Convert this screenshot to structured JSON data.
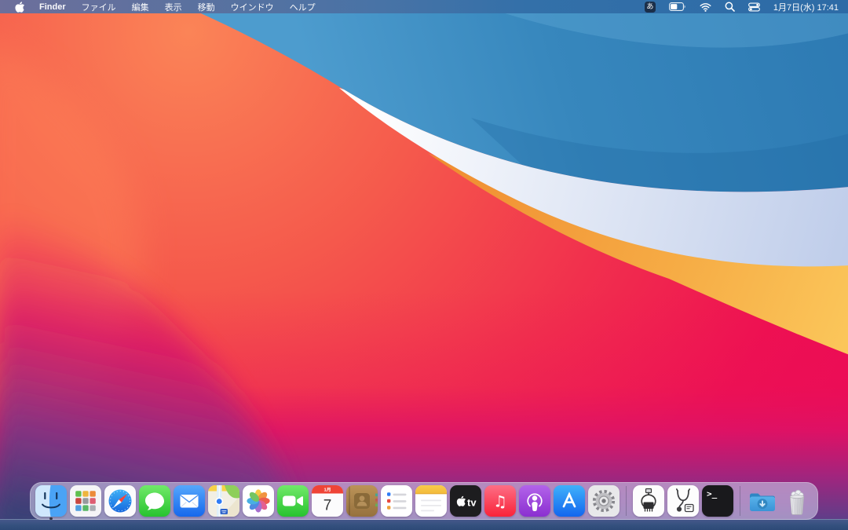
{
  "menu_bar": {
    "app_menu": "Finder",
    "menus": [
      "ファイル",
      "編集",
      "表示",
      "移動",
      "ウインドウ",
      "ヘルプ"
    ],
    "status": {
      "input_method": "あ",
      "battery_fill_ratio": 0.55,
      "clock": "1月7日(水) 17:41"
    },
    "status_icons": [
      "input-method",
      "battery",
      "wifi",
      "spotlight",
      "control-center"
    ]
  },
  "dock": {
    "items": [
      {
        "label": "Finder",
        "icon": "finder-icon",
        "running": true
      },
      {
        "label": "Launchpad",
        "icon": "launchpad-icon",
        "running": false
      },
      {
        "label": "Safari",
        "icon": "safari-icon",
        "running": false
      },
      {
        "label": "Messages",
        "icon": "messages-icon",
        "running": false
      },
      {
        "label": "Mail",
        "icon": "mail-icon",
        "running": false
      },
      {
        "label": "Maps",
        "icon": "maps-icon",
        "running": false
      },
      {
        "label": "Photos",
        "icon": "photos-icon",
        "running": false
      },
      {
        "label": "FaceTime",
        "icon": "facetime-icon",
        "running": false
      },
      {
        "label": "Calendar",
        "icon": "calendar-icon",
        "running": false
      },
      {
        "label": "Contacts",
        "icon": "contacts-icon",
        "running": false
      },
      {
        "label": "Reminders",
        "icon": "reminders-icon",
        "running": false
      },
      {
        "label": "Notes",
        "icon": "notes-icon",
        "running": false
      },
      {
        "label": "TV",
        "icon": "tv-icon",
        "running": false
      },
      {
        "label": "Music",
        "icon": "music-icon",
        "running": false
      },
      {
        "label": "Podcasts",
        "icon": "podcasts-icon",
        "running": false
      },
      {
        "label": "App Store",
        "icon": "app-store-icon",
        "running": false
      },
      {
        "label": "System Preferences",
        "icon": "system-preferences-icon",
        "running": false
      },
      {
        "label": "Hardware Utility",
        "icon": "hardware-utility-icon",
        "running": false
      },
      {
        "label": "Diagnostics Utility",
        "icon": "diagnostics-utility-icon",
        "running": false
      },
      {
        "label": "Terminal",
        "icon": "terminal-icon",
        "running": false
      },
      {
        "label": "Downloads",
        "icon": "downloads-folder-icon",
        "running": false
      },
      {
        "label": "Trash",
        "icon": "trash-full-icon",
        "running": false
      }
    ],
    "calendar": {
      "month": "1月",
      "day": "7"
    },
    "tv_label": "tv",
    "terminal_glyph": ">_",
    "music_glyph": "♫"
  },
  "wallpaper": {
    "name": "big-sur-waves",
    "colors": {
      "blue": "#3787bd",
      "white_band": "#e9eef9",
      "orange": "#f5a843",
      "red": "#f2414b",
      "crimson": "#ed0f52",
      "magenta": "#d0146e",
      "purple": "#7a3f92",
      "slate_bottom": "#34507e"
    }
  }
}
